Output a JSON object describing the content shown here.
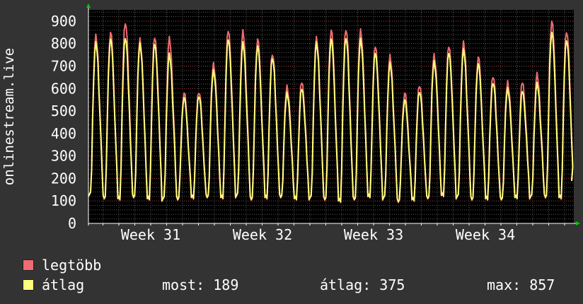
{
  "chart_data": {
    "type": "line",
    "ylabel": "onlinestream.live",
    "ylim": [
      0,
      950
    ],
    "yticks": [
      0,
      100,
      200,
      300,
      400,
      500,
      600,
      700,
      800,
      900
    ],
    "xlabels": [
      "Week 31",
      "Week 32",
      "Week 33",
      "Week 34"
    ],
    "grid": true,
    "colors": {
      "max": "#ee6c72",
      "avg": "#ffff7c",
      "grid_minor": "#5a5a5a",
      "grid_major": "#b04040",
      "axis": "#ffffff",
      "arrow": "#00cc00"
    },
    "series": [
      {
        "name": "legtöbb",
        "peaks": [
          830,
          850,
          900,
          820,
          830,
          820,
          580,
          590,
          710,
          860,
          850,
          820,
          760,
          610,
          630,
          820,
          860,
          870,
          860,
          790,
          740,
          580,
          620,
          750,
          790,
          800,
          740,
          660,
          630,
          630,
          660,
          900,
          860
        ],
        "troughs": [
          130,
          120,
          115,
          120,
          110,
          110,
          115,
          120,
          120,
          115,
          125,
          115,
          120,
          120,
          110,
          115,
          115,
          105,
          110,
          120,
          115,
          105,
          110,
          115,
          125,
          120,
          115,
          115,
          110,
          115,
          120,
          125,
          120
        ]
      },
      {
        "name": "átlag",
        "peaks": [
          800,
          820,
          830,
          800,
          800,
          750,
          560,
          570,
          680,
          820,
          800,
          790,
          740,
          580,
          600,
          800,
          820,
          830,
          820,
          760,
          710,
          550,
          590,
          720,
          760,
          770,
          710,
          630,
          600,
          590,
          620,
          850,
          820
        ],
        "troughs": [
          130,
          120,
          115,
          120,
          110,
          110,
          115,
          120,
          120,
          115,
          125,
          115,
          120,
          120,
          110,
          115,
          115,
          105,
          110,
          120,
          115,
          105,
          110,
          115,
          125,
          120,
          115,
          115,
          110,
          115,
          120,
          125,
          120
        ]
      }
    ]
  },
  "legend": {
    "max_label": "legtöbb",
    "avg_label": "átlag",
    "now_text": "most: 189",
    "avg_text": "átlag: 375",
    "max_text": "max: 857"
  }
}
